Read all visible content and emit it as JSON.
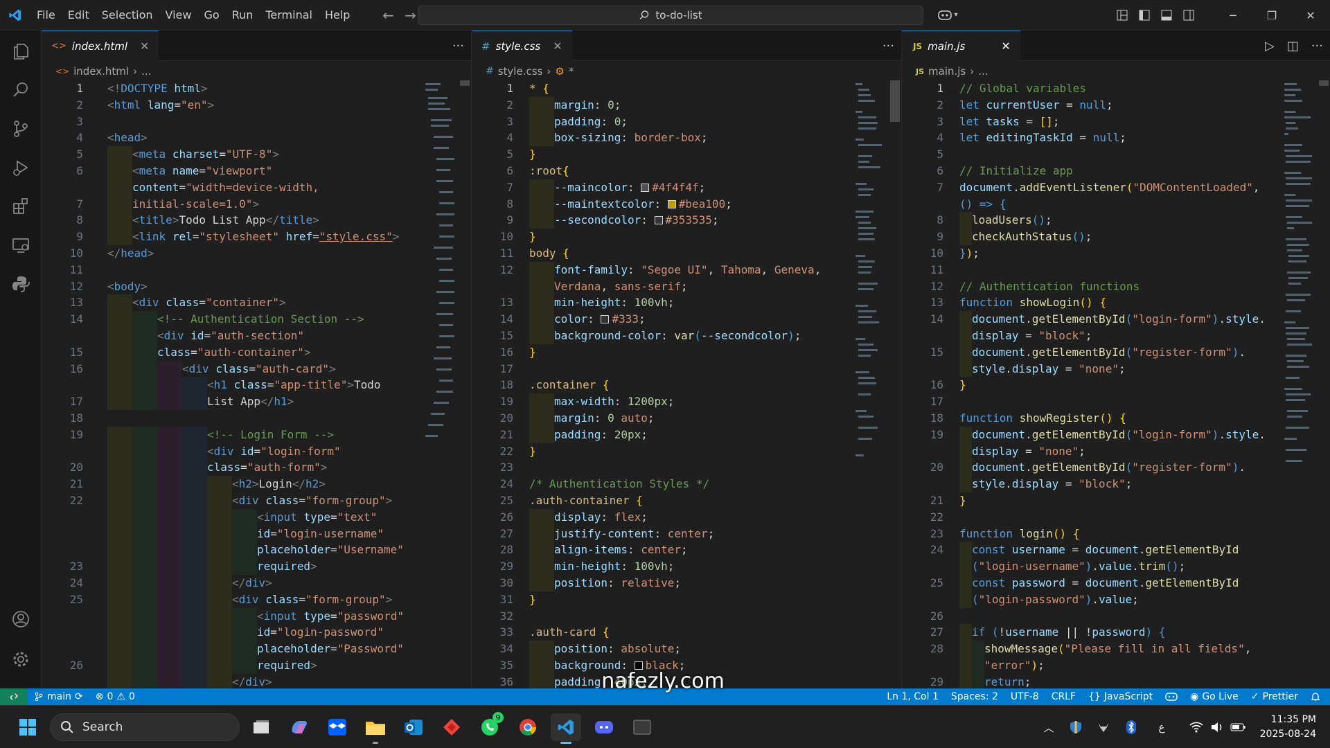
{
  "titlebar": {
    "menu": [
      "File",
      "Edit",
      "Selection",
      "View",
      "Go",
      "Run",
      "Terminal",
      "Help"
    ],
    "search": "to-do-list"
  },
  "editors": {
    "html": {
      "tab": "index.html",
      "breadcrumb_file": "index.html",
      "breadcrumb_rest": "...",
      "line_numbers": [
        "1",
        "2",
        "3",
        "4",
        "5",
        "6",
        "",
        "7",
        "8",
        "9",
        "10",
        "11",
        "12",
        "13",
        "14",
        "",
        "15",
        "16",
        "",
        "17",
        "18",
        "19",
        "",
        "20",
        "21",
        "22",
        "",
        "",
        "",
        "23",
        "24",
        "25",
        "",
        "",
        "",
        "26"
      ]
    },
    "css": {
      "tab": "style.css",
      "breadcrumb_file": "style.css",
      "breadcrumb_rest": "*",
      "line_numbers": [
        "1",
        "2",
        "3",
        "4",
        "5",
        "6",
        "7",
        "8",
        "9",
        "10",
        "11",
        "12",
        "",
        "13",
        "14",
        "15",
        "16",
        "17",
        "18",
        "19",
        "20",
        "21",
        "22",
        "23",
        "24",
        "25",
        "26",
        "27",
        "28",
        "29",
        "30",
        "31",
        "32",
        "33",
        "34",
        "35",
        "36"
      ]
    },
    "js": {
      "tab": "main.js",
      "breadcrumb_file": "main.js",
      "breadcrumb_rest": "...",
      "line_numbers": [
        "1",
        "2",
        "3",
        "4",
        "5",
        "6",
        "7",
        "",
        "8",
        "9",
        "10",
        "11",
        "12",
        "13",
        "14",
        "",
        "15",
        "",
        "16",
        "17",
        "18",
        "19",
        "",
        "20",
        "",
        "21",
        "22",
        "23",
        "24",
        "",
        "25",
        "",
        "26",
        "27",
        "28",
        "",
        "29"
      ]
    }
  },
  "statusbar": {
    "branch": "main",
    "errors": "0",
    "warnings": "0",
    "position": "Ln 1, Col 1",
    "spaces": "Spaces: 2",
    "encoding": "UTF-8",
    "eol": "CRLF",
    "language": "JavaScript",
    "golive": "Go Live",
    "prettier": "Prettier"
  },
  "taskbar": {
    "search": "Search",
    "whatsapp_badge": "9",
    "time": "11:35 PM",
    "date": "2025-08-24",
    "lang": "ع"
  },
  "watermark": "nafezly.com",
  "colors": {
    "accent": "#007acc",
    "editor_bg": "#1f1f1f",
    "titlebar_bg": "#1f1f1f"
  }
}
